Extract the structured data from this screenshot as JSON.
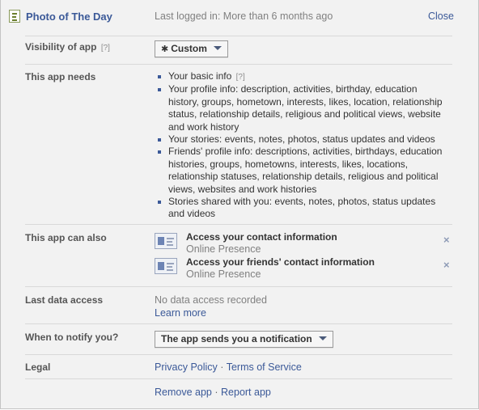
{
  "header": {
    "app_title": "Photo of The Day",
    "last_logged": "Last logged in: More than 6 months ago",
    "close": "Close",
    "icon": "app-icon"
  },
  "visibility": {
    "label": "Visibility of app",
    "help": "[?]",
    "button": "Custom",
    "icon": "gear-icon"
  },
  "needs": {
    "label": "This app needs",
    "basic": "Your basic info",
    "basic_help": "[?]",
    "items": [
      "Your profile info: description, activities, birthday, education history, groups, hometown, interests, likes, location, relationship status, relationship details, religious and political views, website and work history",
      "Your stories: events, notes, photos, status updates and videos",
      "Friends' profile info: descriptions, activities, birthdays, education histories, groups, hometowns, interests, likes, locations, relationship statuses, relationship details, religious and political views, websites and work histories",
      "Stories shared with you: events, notes, photos, status updates and videos"
    ]
  },
  "also": {
    "label": "This app can also",
    "permissions": [
      {
        "title": "Access your contact information",
        "sub": "Online Presence",
        "remove": "×"
      },
      {
        "title": "Access your friends' contact information",
        "sub": "Online Presence",
        "remove": "×"
      }
    ]
  },
  "data_access": {
    "label": "Last data access",
    "value": "No data access recorded",
    "link": "Learn more"
  },
  "notify": {
    "label": "When to notify you?",
    "button": "The app sends you a notification"
  },
  "legal": {
    "label": "Legal",
    "privacy": "Privacy Policy",
    "sep": "·",
    "terms": "Terms of Service"
  },
  "footer": {
    "remove": "Remove app",
    "sep": "·",
    "report": "Report app"
  },
  "colors": {
    "link": "#3b5998",
    "panel_bg": "#f2f2f2",
    "muted": "#808080"
  }
}
